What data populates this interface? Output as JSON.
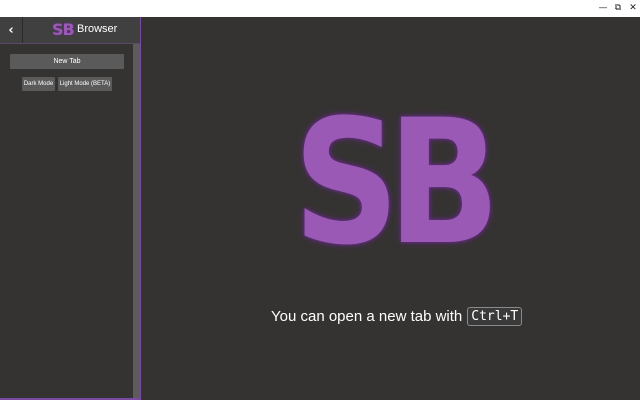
{
  "window": {
    "minimize_icon": "minimize-icon",
    "maximize_icon": "restore-icon",
    "close_icon": "close-icon",
    "minimize_glyph": "—",
    "maximize_glyph": "⧉",
    "close_glyph": "✕"
  },
  "sidebar": {
    "back_icon": "chevron-left-icon",
    "back_glyph": "‹",
    "logo_text": "SB",
    "app_title": "Browser",
    "new_tab_label": "New Tab",
    "dark_mode_label": "Dark Mode",
    "light_mode_label": "Light Mode (BETA)"
  },
  "main": {
    "logo_text": "SB",
    "hint_text": "You can open a new tab with",
    "shortcut": "Ctrl+T"
  },
  "colors": {
    "accent": "#9b59b6",
    "background": "#353331",
    "button": "#5a5a5a"
  }
}
